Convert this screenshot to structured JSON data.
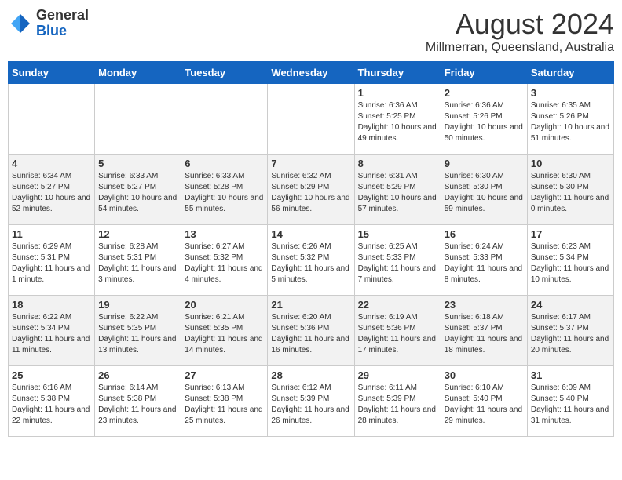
{
  "header": {
    "logo_line1": "General",
    "logo_line2": "Blue",
    "month_year": "August 2024",
    "location": "Millmerran, Queensland, Australia"
  },
  "days_of_week": [
    "Sunday",
    "Monday",
    "Tuesday",
    "Wednesday",
    "Thursday",
    "Friday",
    "Saturday"
  ],
  "weeks": [
    [
      {
        "day": "",
        "info": ""
      },
      {
        "day": "",
        "info": ""
      },
      {
        "day": "",
        "info": ""
      },
      {
        "day": "",
        "info": ""
      },
      {
        "day": "1",
        "info": "Sunrise: 6:36 AM\nSunset: 5:25 PM\nDaylight: 10 hours and 49 minutes."
      },
      {
        "day": "2",
        "info": "Sunrise: 6:36 AM\nSunset: 5:26 PM\nDaylight: 10 hours and 50 minutes."
      },
      {
        "day": "3",
        "info": "Sunrise: 6:35 AM\nSunset: 5:26 PM\nDaylight: 10 hours and 51 minutes."
      }
    ],
    [
      {
        "day": "4",
        "info": "Sunrise: 6:34 AM\nSunset: 5:27 PM\nDaylight: 10 hours and 52 minutes."
      },
      {
        "day": "5",
        "info": "Sunrise: 6:33 AM\nSunset: 5:27 PM\nDaylight: 10 hours and 54 minutes."
      },
      {
        "day": "6",
        "info": "Sunrise: 6:33 AM\nSunset: 5:28 PM\nDaylight: 10 hours and 55 minutes."
      },
      {
        "day": "7",
        "info": "Sunrise: 6:32 AM\nSunset: 5:29 PM\nDaylight: 10 hours and 56 minutes."
      },
      {
        "day": "8",
        "info": "Sunrise: 6:31 AM\nSunset: 5:29 PM\nDaylight: 10 hours and 57 minutes."
      },
      {
        "day": "9",
        "info": "Sunrise: 6:30 AM\nSunset: 5:30 PM\nDaylight: 10 hours and 59 minutes."
      },
      {
        "day": "10",
        "info": "Sunrise: 6:30 AM\nSunset: 5:30 PM\nDaylight: 11 hours and 0 minutes."
      }
    ],
    [
      {
        "day": "11",
        "info": "Sunrise: 6:29 AM\nSunset: 5:31 PM\nDaylight: 11 hours and 1 minute."
      },
      {
        "day": "12",
        "info": "Sunrise: 6:28 AM\nSunset: 5:31 PM\nDaylight: 11 hours and 3 minutes."
      },
      {
        "day": "13",
        "info": "Sunrise: 6:27 AM\nSunset: 5:32 PM\nDaylight: 11 hours and 4 minutes."
      },
      {
        "day": "14",
        "info": "Sunrise: 6:26 AM\nSunset: 5:32 PM\nDaylight: 11 hours and 5 minutes."
      },
      {
        "day": "15",
        "info": "Sunrise: 6:25 AM\nSunset: 5:33 PM\nDaylight: 11 hours and 7 minutes."
      },
      {
        "day": "16",
        "info": "Sunrise: 6:24 AM\nSunset: 5:33 PM\nDaylight: 11 hours and 8 minutes."
      },
      {
        "day": "17",
        "info": "Sunrise: 6:23 AM\nSunset: 5:34 PM\nDaylight: 11 hours and 10 minutes."
      }
    ],
    [
      {
        "day": "18",
        "info": "Sunrise: 6:22 AM\nSunset: 5:34 PM\nDaylight: 11 hours and 11 minutes."
      },
      {
        "day": "19",
        "info": "Sunrise: 6:22 AM\nSunset: 5:35 PM\nDaylight: 11 hours and 13 minutes."
      },
      {
        "day": "20",
        "info": "Sunrise: 6:21 AM\nSunset: 5:35 PM\nDaylight: 11 hours and 14 minutes."
      },
      {
        "day": "21",
        "info": "Sunrise: 6:20 AM\nSunset: 5:36 PM\nDaylight: 11 hours and 16 minutes."
      },
      {
        "day": "22",
        "info": "Sunrise: 6:19 AM\nSunset: 5:36 PM\nDaylight: 11 hours and 17 minutes."
      },
      {
        "day": "23",
        "info": "Sunrise: 6:18 AM\nSunset: 5:37 PM\nDaylight: 11 hours and 18 minutes."
      },
      {
        "day": "24",
        "info": "Sunrise: 6:17 AM\nSunset: 5:37 PM\nDaylight: 11 hours and 20 minutes."
      }
    ],
    [
      {
        "day": "25",
        "info": "Sunrise: 6:16 AM\nSunset: 5:38 PM\nDaylight: 11 hours and 22 minutes."
      },
      {
        "day": "26",
        "info": "Sunrise: 6:14 AM\nSunset: 5:38 PM\nDaylight: 11 hours and 23 minutes."
      },
      {
        "day": "27",
        "info": "Sunrise: 6:13 AM\nSunset: 5:38 PM\nDaylight: 11 hours and 25 minutes."
      },
      {
        "day": "28",
        "info": "Sunrise: 6:12 AM\nSunset: 5:39 PM\nDaylight: 11 hours and 26 minutes."
      },
      {
        "day": "29",
        "info": "Sunrise: 6:11 AM\nSunset: 5:39 PM\nDaylight: 11 hours and 28 minutes."
      },
      {
        "day": "30",
        "info": "Sunrise: 6:10 AM\nSunset: 5:40 PM\nDaylight: 11 hours and 29 minutes."
      },
      {
        "day": "31",
        "info": "Sunrise: 6:09 AM\nSunset: 5:40 PM\nDaylight: 11 hours and 31 minutes."
      }
    ]
  ]
}
